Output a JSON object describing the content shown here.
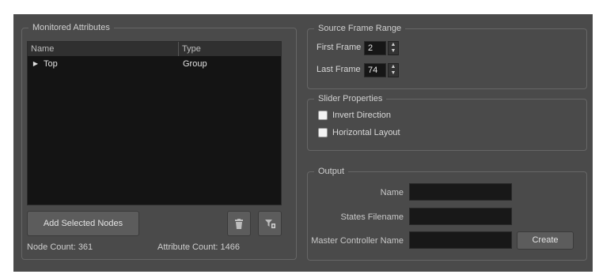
{
  "monitored": {
    "title": "Monitored Attributes",
    "columns": {
      "name": "Name",
      "type": "Type"
    },
    "rows": [
      {
        "name": "Top",
        "type": "Group"
      }
    ],
    "add_button": "Add Selected Nodes",
    "node_count": "Node Count: 361",
    "attribute_count": "Attribute Count: 1466",
    "icons": {
      "delete": "trash-icon",
      "filter": "filter-delete-icon"
    }
  },
  "frame_range": {
    "title": "Source Frame Range",
    "first_label": "First Frame",
    "first_value": "2",
    "last_label": "Last Frame",
    "last_value": "74"
  },
  "slider": {
    "title": "Slider Properties",
    "invert": "Invert Direction",
    "horizontal": "Horizontal Layout"
  },
  "output": {
    "title": "Output",
    "name_label": "Name",
    "states_label": "States Filename",
    "master_label": "Master Controller Name",
    "create_button": "Create"
  },
  "colors": {
    "panel": "#4a4a4a",
    "tree_bg": "#141414",
    "field_bg": "#181818",
    "button": "#5c5c5c"
  }
}
